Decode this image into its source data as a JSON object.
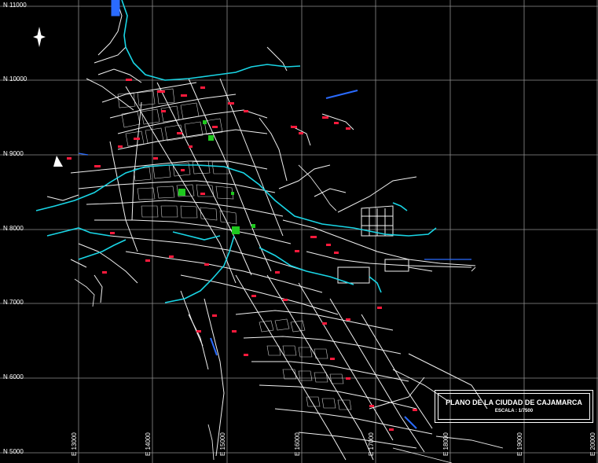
{
  "title_block": {
    "title": "PLANO DE LA CIUDAD DE CAJAMARCA",
    "scale": "ESCALA : 1/7500"
  },
  "grid": {
    "northings": [
      "N 11000",
      "N 10000",
      "N 9000",
      "N 8000",
      "N 7000",
      "N 6000",
      "N 5000"
    ],
    "eastings": [
      "E 13000",
      "E 14000",
      "E 15000",
      "E 16000",
      "E 17000",
      "E 18000",
      "E 19000",
      "E 20000"
    ]
  },
  "colors": {
    "background": "#000000",
    "streets": "#ffffff",
    "rivers": "#19d6e6",
    "blocks_highlight": "#ff1a3c",
    "parks": "#1ec81e",
    "grid": "#9a9a9a",
    "labels_blue": "#2a6bff"
  },
  "icons": {
    "north_arrow": "north-arrow-icon"
  }
}
